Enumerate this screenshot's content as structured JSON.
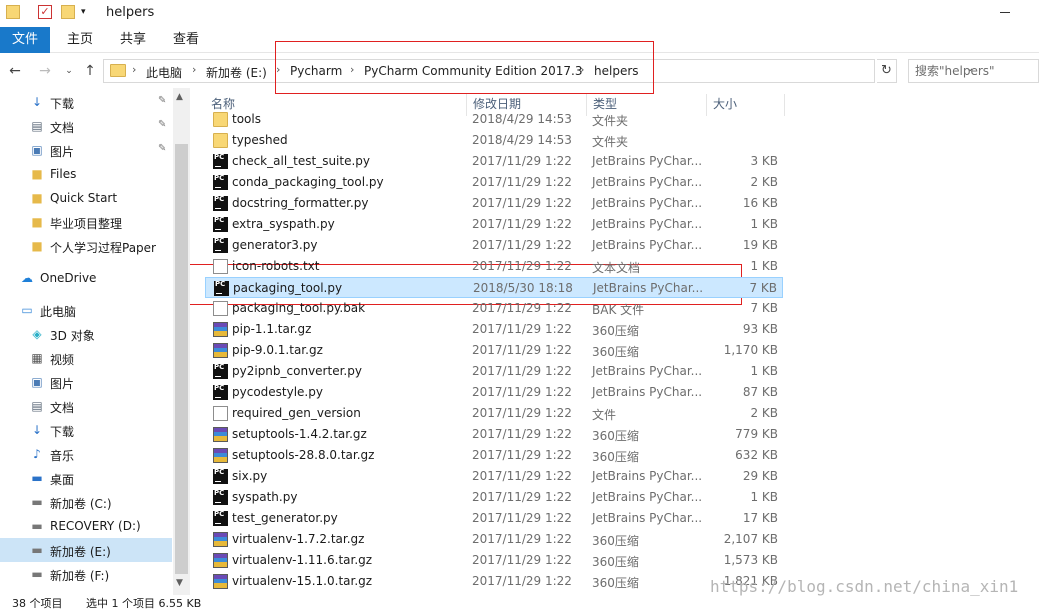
{
  "window": {
    "title": "helpers"
  },
  "ribbon": {
    "tabs": [
      "文件",
      "主页",
      "共享",
      "查看"
    ]
  },
  "address": {
    "crumbs": [
      "此电脑",
      "新加卷 (E:)",
      "Pycharm",
      "PyCharm Community Edition 2017.3",
      "helpers"
    ],
    "search_placeholder": "搜索\"helpers\""
  },
  "sidebar": {
    "items": [
      {
        "label": "下载",
        "icon": "download-icon",
        "pinned": true
      },
      {
        "label": "文档",
        "icon": "document-icon",
        "pinned": true
      },
      {
        "label": "图片",
        "icon": "picture-icon",
        "pinned": true
      },
      {
        "label": "Files",
        "icon": "folder-icon",
        "pinned": false
      },
      {
        "label": "Quick Start",
        "icon": "folder-icon",
        "pinned": false
      },
      {
        "label": "毕业项目整理",
        "icon": "folder-icon",
        "pinned": false
      },
      {
        "label": "个人学习过程Paper",
        "icon": "folder-icon",
        "pinned": false
      },
      {
        "label": "OneDrive",
        "icon": "cloud-icon",
        "pinned": false
      },
      {
        "label": "此电脑",
        "icon": "computer-icon",
        "pinned": false
      },
      {
        "label": "3D 对象",
        "icon": "cube-icon",
        "pinned": false
      },
      {
        "label": "视频",
        "icon": "video-icon",
        "pinned": false
      },
      {
        "label": "图片",
        "icon": "picture-icon",
        "pinned": false
      },
      {
        "label": "文档",
        "icon": "document-icon",
        "pinned": false
      },
      {
        "label": "下载",
        "icon": "download-icon",
        "pinned": false
      },
      {
        "label": "音乐",
        "icon": "music-icon",
        "pinned": false
      },
      {
        "label": "桌面",
        "icon": "desktop-icon",
        "pinned": false
      },
      {
        "label": "新加卷 (C:)",
        "icon": "drive-icon",
        "pinned": false
      },
      {
        "label": "RECOVERY (D:)",
        "icon": "drive-icon",
        "pinned": false
      },
      {
        "label": "新加卷 (E:)",
        "icon": "drive-icon",
        "pinned": false,
        "selected": true
      },
      {
        "label": "新加卷 (F:)",
        "icon": "drive-icon",
        "pinned": false
      }
    ]
  },
  "filelist": {
    "headers": {
      "name": "名称",
      "date": "修改日期",
      "type": "类型",
      "size": "大小"
    },
    "rows": [
      {
        "name": "tools",
        "date": "2018/4/29 14:53",
        "type": "文件夹",
        "size": "",
        "icon": "folder"
      },
      {
        "name": "typeshed",
        "date": "2018/4/29 14:53",
        "type": "文件夹",
        "size": "",
        "icon": "folder"
      },
      {
        "name": "check_all_test_suite.py",
        "date": "2017/11/29 1:22",
        "type": "JetBrains PyChar...",
        "size": "3 KB",
        "icon": "pc"
      },
      {
        "name": "conda_packaging_tool.py",
        "date": "2017/11/29 1:22",
        "type": "JetBrains PyChar...",
        "size": "2 KB",
        "icon": "pc"
      },
      {
        "name": "docstring_formatter.py",
        "date": "2017/11/29 1:22",
        "type": "JetBrains PyChar...",
        "size": "16 KB",
        "icon": "pc"
      },
      {
        "name": "extra_syspath.py",
        "date": "2017/11/29 1:22",
        "type": "JetBrains PyChar...",
        "size": "1 KB",
        "icon": "pc"
      },
      {
        "name": "generator3.py",
        "date": "2017/11/29 1:22",
        "type": "JetBrains PyChar...",
        "size": "19 KB",
        "icon": "pc"
      },
      {
        "name": "icon-robots.txt",
        "date": "2017/11/29 1:22",
        "type": "文本文档",
        "size": "1 KB",
        "icon": "txt"
      },
      {
        "name": "packaging_tool.py",
        "date": "2018/5/30 18:18",
        "type": "JetBrains PyChar...",
        "size": "7 KB",
        "icon": "pc",
        "selected": true
      },
      {
        "name": "packaging_tool.py.bak",
        "date": "2017/11/29 1:22",
        "type": "BAK 文件",
        "size": "7 KB",
        "icon": "txt"
      },
      {
        "name": "pip-1.1.tar.gz",
        "date": "2017/11/29 1:22",
        "type": "360压缩",
        "size": "93 KB",
        "icon": "zip"
      },
      {
        "name": "pip-9.0.1.tar.gz",
        "date": "2017/11/29 1:22",
        "type": "360压缩",
        "size": "1,170 KB",
        "icon": "zip"
      },
      {
        "name": "py2ipnb_converter.py",
        "date": "2017/11/29 1:22",
        "type": "JetBrains PyChar...",
        "size": "1 KB",
        "icon": "pc"
      },
      {
        "name": "pycodestyle.py",
        "date": "2017/11/29 1:22",
        "type": "JetBrains PyChar...",
        "size": "87 KB",
        "icon": "pc"
      },
      {
        "name": "required_gen_version",
        "date": "2017/11/29 1:22",
        "type": "文件",
        "size": "2 KB",
        "icon": "txt"
      },
      {
        "name": "setuptools-1.4.2.tar.gz",
        "date": "2017/11/29 1:22",
        "type": "360压缩",
        "size": "779 KB",
        "icon": "zip"
      },
      {
        "name": "setuptools-28.8.0.tar.gz",
        "date": "2017/11/29 1:22",
        "type": "360压缩",
        "size": "632 KB",
        "icon": "zip"
      },
      {
        "name": "six.py",
        "date": "2017/11/29 1:22",
        "type": "JetBrains PyChar...",
        "size": "29 KB",
        "icon": "pc"
      },
      {
        "name": "syspath.py",
        "date": "2017/11/29 1:22",
        "type": "JetBrains PyChar...",
        "size": "1 KB",
        "icon": "pc"
      },
      {
        "name": "test_generator.py",
        "date": "2017/11/29 1:22",
        "type": "JetBrains PyChar...",
        "size": "17 KB",
        "icon": "pc"
      },
      {
        "name": "virtualenv-1.7.2.tar.gz",
        "date": "2017/11/29 1:22",
        "type": "360压缩",
        "size": "2,107 KB",
        "icon": "zip"
      },
      {
        "name": "virtualenv-1.11.6.tar.gz",
        "date": "2017/11/29 1:22",
        "type": "360压缩",
        "size": "1,573 KB",
        "icon": "zip"
      },
      {
        "name": "virtualenv-15.1.0.tar.gz",
        "date": "2017/11/29 1:22",
        "type": "360压缩",
        "size": "1,821 KB",
        "icon": "zip"
      }
    ]
  },
  "status": {
    "count": "38 个项目",
    "selection": "选中 1 个项目  6.55 KB"
  },
  "watermark": "https://blog.csdn.net/china_xin1",
  "colors": {
    "accent": "#1979ca",
    "selection": "#cce8ff",
    "highlight_box": "#e02020"
  }
}
